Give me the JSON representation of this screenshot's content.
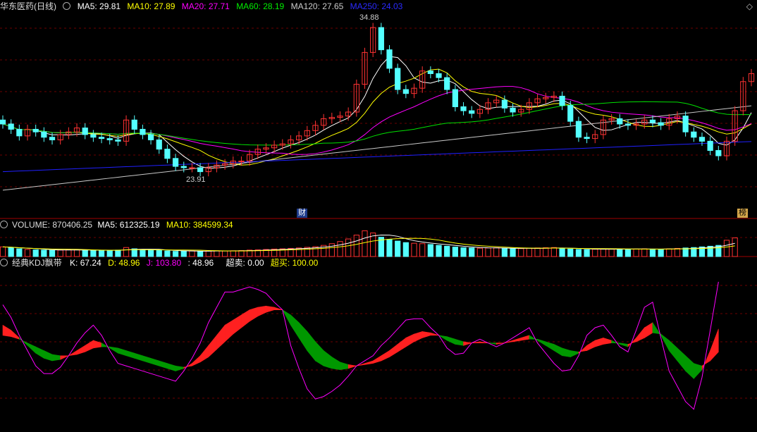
{
  "colors": {
    "bg": "#000000",
    "up": "#ff3232",
    "down": "#54ffff",
    "grid": "#6b0000",
    "ma5": "#ffffff",
    "ma10": "#ffff00",
    "ma20": "#ff00ff",
    "ma60": "#00e000",
    "ma120": "#c8c8c8",
    "ma250": "#2020ff",
    "k_rise": "#ff2020",
    "k_fall": "#009800",
    "j": "#ff00ff"
  },
  "header": {
    "stock_name": "华东医药(日线)",
    "ma5": "MA5: 29.81",
    "ma10": "MA10: 27.89",
    "ma20": "MA20: 27.71",
    "ma60": "MA60: 28.19",
    "ma120": "MA120: 27.65",
    "ma250": "MA250: 24.03",
    "corner_icon": "diamond-icon"
  },
  "volume_header": {
    "volume": "VOLUME: 870406.25",
    "ma5": "MA5: 612325.19",
    "ma10": "MA10: 384599.34"
  },
  "kdj_header": {
    "title": "经典KDJ飘带",
    "k": "K: 67.24",
    "d": "D: 48.96",
    "j": "J: 103.80",
    "extra": ": 48.96",
    "oversold": "超卖: 0.00",
    "overbought": "超买: 100.00"
  },
  "annotations": {
    "high": "34.88",
    "low": "23.91",
    "marker_cai": "财",
    "marker_bang": "榜"
  },
  "chart_data": {
    "type": "candlestick",
    "count": 88,
    "price_range": [
      21.0,
      36.0
    ],
    "high_value": 34.88,
    "low_value": 23.91,
    "closes": [
      27.6,
      27.2,
      26.7,
      27.2,
      27.0,
      26.6,
      26.4,
      26.8,
      27.0,
      27.3,
      26.8,
      26.6,
      26.5,
      26.4,
      26.3,
      27.9,
      27.2,
      26.8,
      26.4,
      25.7,
      25.0,
      24.4,
      24.3,
      24.3,
      24.0,
      24.3,
      24.5,
      24.6,
      24.8,
      24.8,
      25.3,
      25.7,
      25.8,
      26.0,
      26.1,
      26.4,
      26.7,
      27.1,
      27.5,
      28.0,
      28.1,
      28.2,
      28.5,
      30.6,
      33.0,
      34.88,
      33.2,
      31.8,
      30.2,
      29.9,
      30.3,
      31.6,
      31.4,
      31.1,
      30.2,
      28.9,
      28.6,
      28.4,
      28.7,
      29.2,
      29.4,
      28.8,
      28.5,
      28.7,
      29.2,
      29.5,
      29.6,
      29.7,
      29.0,
      27.8,
      26.6,
      26.5,
      26.8,
      27.9,
      28.0,
      27.6,
      27.5,
      27.6,
      27.9,
      27.7,
      27.5,
      28.0,
      28.2,
      27.0,
      26.6,
      26.3,
      25.6,
      25.2,
      26.3,
      28.6,
      30.8,
      31.4
    ],
    "ma_ribbon_note": "",
    "volume": [
      450,
      420,
      360,
      330,
      310,
      300,
      290,
      300,
      320,
      310,
      300,
      280,
      270,
      290,
      300,
      420,
      360,
      330,
      300,
      280,
      260,
      240,
      250,
      260,
      250,
      260,
      270,
      260,
      270,
      280,
      300,
      310,
      330,
      350,
      360,
      380,
      400,
      430,
      460,
      520,
      600,
      700,
      820,
      1000,
      1200,
      1100,
      900,
      800,
      720,
      650,
      620,
      600,
      560,
      520,
      480,
      440,
      410,
      400,
      390,
      400,
      410,
      380,
      360,
      370,
      390,
      400,
      410,
      420,
      380,
      350,
      330,
      320,
      340,
      360,
      360,
      350,
      340,
      350,
      360,
      350,
      340,
      360,
      380,
      400,
      420,
      450,
      480,
      520,
      760,
      870
    ],
    "volume_range": [
      0,
      1250
    ],
    "k_values": [
      70,
      66,
      60,
      54,
      48,
      44,
      42,
      43,
      46,
      50,
      54,
      58,
      56,
      52,
      48,
      46,
      44,
      42,
      40,
      38,
      36,
      34,
      36,
      40,
      46,
      54,
      62,
      70,
      74,
      78,
      82,
      84,
      85,
      84,
      82,
      70,
      60,
      50,
      42,
      38,
      36,
      35,
      36,
      38,
      40,
      42,
      46,
      50,
      55,
      60,
      63,
      65,
      64,
      62,
      58,
      55,
      54,
      56,
      57,
      56,
      55,
      56,
      58,
      60,
      62,
      58,
      54,
      50,
      46,
      45,
      48,
      54,
      58,
      60,
      58,
      55,
      53,
      60,
      68,
      72,
      62,
      50,
      42,
      34,
      28,
      35,
      50,
      67
    ],
    "d_values": [
      62,
      61,
      59,
      56,
      53,
      50,
      47,
      46,
      46,
      47,
      49,
      52,
      53,
      53,
      52,
      50,
      48,
      46,
      44,
      42,
      40,
      38,
      37,
      38,
      41,
      45,
      51,
      57,
      63,
      68,
      73,
      77,
      80,
      82,
      82,
      78,
      72,
      65,
      57,
      50,
      45,
      41,
      39,
      38,
      39,
      40,
      42,
      45,
      49,
      53,
      57,
      60,
      62,
      62,
      61,
      59,
      57,
      56,
      56,
      56,
      56,
      56,
      57,
      58,
      59,
      59,
      57,
      55,
      52,
      50,
      49,
      50,
      53,
      55,
      56,
      56,
      55,
      57,
      60,
      64,
      63,
      58,
      52,
      46,
      40,
      38,
      42,
      49
    ],
    "j_values": [
      86,
      76,
      62,
      50,
      38,
      32,
      32,
      37,
      46,
      56,
      64,
      70,
      62,
      50,
      40,
      38,
      36,
      34,
      32,
      30,
      28,
      26,
      34,
      44,
      56,
      72,
      84,
      96,
      96,
      98,
      100,
      98,
      95,
      88,
      82,
      54,
      36,
      20,
      12,
      14,
      18,
      23,
      30,
      38,
      42,
      46,
      54,
      60,
      67,
      74,
      75,
      75,
      68,
      62,
      52,
      47,
      48,
      56,
      59,
      56,
      53,
      56,
      60,
      64,
      68,
      56,
      48,
      40,
      34,
      35,
      46,
      62,
      68,
      70,
      62,
      53,
      49,
      66,
      84,
      88,
      60,
      34,
      22,
      10,
      4,
      29,
      66,
      104
    ],
    "kdj_range": [
      -10,
      115
    ]
  }
}
